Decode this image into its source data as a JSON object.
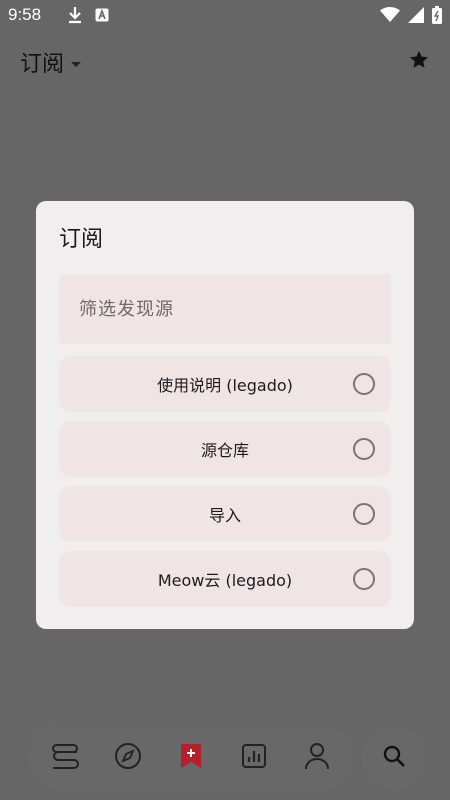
{
  "status_bar": {
    "time": "9:58"
  },
  "app_bar": {
    "title": "订阅"
  },
  "dialog": {
    "title": "订阅",
    "filter_placeholder": "筛选发现源",
    "options": [
      {
        "label": "使用说明 (legado)",
        "selected": false
      },
      {
        "label": "源仓库",
        "selected": false
      },
      {
        "label": "导入",
        "selected": false
      },
      {
        "label": "Meow云 (legado)",
        "selected": false
      }
    ]
  },
  "bottom_nav": {
    "items": [
      {
        "icon": "bookshelf-icon",
        "active": false
      },
      {
        "icon": "compass-icon",
        "active": false
      },
      {
        "icon": "rss-bookmark-icon",
        "active": true
      },
      {
        "icon": "chart-icon",
        "active": false
      },
      {
        "icon": "person-icon",
        "active": false
      }
    ],
    "search_icon": "search-icon"
  },
  "colors": {
    "scrim": "#666666",
    "dialog_bg": "#f0eeee",
    "option_bg": "#efe5e4",
    "accent": "#b3212d"
  }
}
